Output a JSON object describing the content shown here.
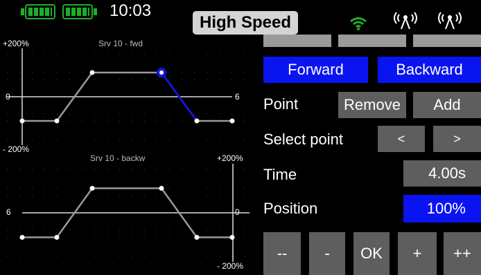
{
  "status": {
    "time": "10:03",
    "flight_mode": "High Speed"
  },
  "chart_forward": {
    "title": "Srv 10 - fwd",
    "y_top": "+200%",
    "y_mid": "0",
    "y_bottom": "- 200%",
    "point_count": "6"
  },
  "chart_backward": {
    "title": "Srv 10 - backw",
    "y_top": "+200%",
    "y_mid": "0",
    "y_bottom": "- 200%",
    "point_count": "6"
  },
  "controls": {
    "forward": "Forward",
    "backward": "Backward",
    "point_label": "Point",
    "remove": "Remove",
    "add": "Add",
    "select_point_label": "Select point",
    "prev": "<",
    "next": ">",
    "time_label": "Time",
    "time_value": "4.00s",
    "position_label": "Position",
    "position_value": "100%",
    "step_big_down": "--",
    "step_down": "-",
    "ok": "OK",
    "step_up": "+",
    "step_big_up": "++"
  },
  "colors": {
    "accent_blue": "#0a14f0",
    "button_gray": "#5e5e5e",
    "battery_green": "#1fae2a",
    "curve_gray": "#9a9a9a",
    "selected_segment": "#1414d8"
  },
  "chart_data": [
    {
      "type": "line",
      "title": "Srv 10 - fwd",
      "ylim": [
        -200,
        200
      ],
      "x": [
        0,
        1,
        2,
        3,
        4,
        5
      ],
      "y": [
        -100,
        -100,
        100,
        100,
        -100,
        -100
      ],
      "selected_point": 3
    },
    {
      "type": "line",
      "title": "Srv 10 - backw",
      "ylim": [
        -200,
        200
      ],
      "x": [
        0,
        1,
        2,
        3,
        4,
        5
      ],
      "y": [
        -100,
        -100,
        100,
        100,
        -100,
        -100
      ]
    }
  ]
}
